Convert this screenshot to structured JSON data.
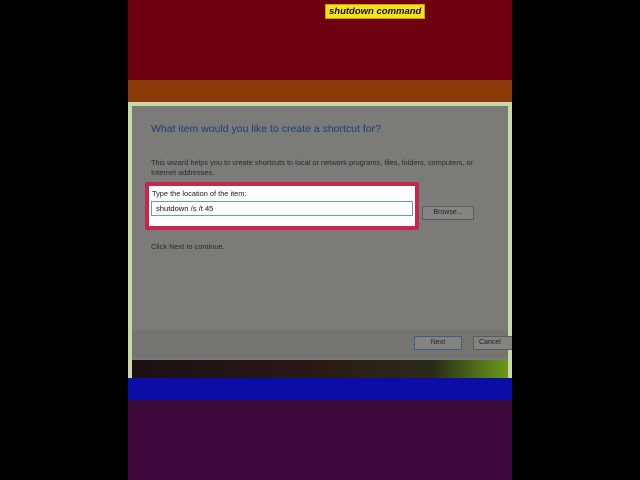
{
  "dialog": {
    "title": "What item would you like to create a shortcut for?",
    "description": "This wizard helps you to create shortcuts to local or network programs, files, folders, computers, or Internet addresses.",
    "location_label": "Type the location of the item:",
    "location_value": "shutdown /s /t 45",
    "browse_label": "Browse...",
    "continue_text": "Click Next to continue.",
    "next_label": "Next",
    "cancel_label": "Cancel"
  },
  "annotation": {
    "tooltip_text": "shutdown command",
    "highlight_color": "#c8264f",
    "tooltip_color": "#f6e21a"
  },
  "colors": {
    "top_band": "#6e0010",
    "orange_band": "#8a3a08",
    "dialog_border": "#c9d9a8",
    "blue_band": "#0c0ca6",
    "bottom_band": "#3e0a3e"
  }
}
